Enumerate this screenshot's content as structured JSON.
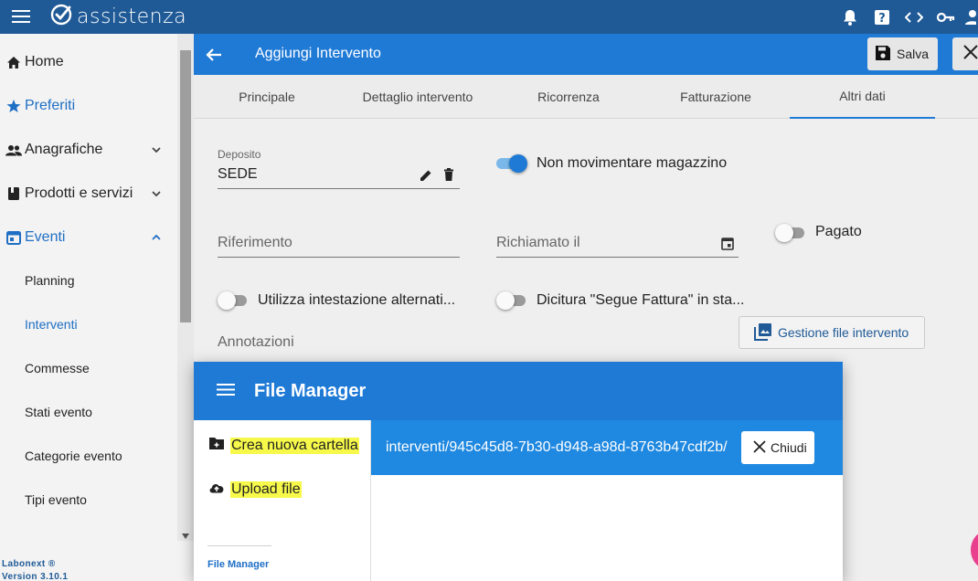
{
  "app": {
    "logo_text": "assistenza"
  },
  "sidebar": {
    "items": [
      {
        "label": "Home"
      },
      {
        "label": "Preferiti"
      },
      {
        "label": "Anagrafiche"
      },
      {
        "label": "Prodotti e servizi"
      },
      {
        "label": "Eventi"
      }
    ],
    "sub_items": [
      {
        "label": "Planning"
      },
      {
        "label": "Interventi"
      },
      {
        "label": "Commesse"
      },
      {
        "label": "Stati evento"
      },
      {
        "label": "Categorie evento"
      },
      {
        "label": "Tipi evento"
      }
    ],
    "footer_name": "Labonext ®",
    "footer_version": "Version 3.10.1"
  },
  "form_header": {
    "title": "Aggiungi Intervento",
    "save_label": "Salva"
  },
  "tabs": [
    {
      "label": "Principale"
    },
    {
      "label": "Dettaglio intervento"
    },
    {
      "label": "Ricorrenza"
    },
    {
      "label": "Fatturazione"
    },
    {
      "label": "Altri dati"
    }
  ],
  "form": {
    "deposito_label": "Deposito",
    "deposito_value": "SEDE",
    "non_movimentare_label": "Non movimentare magazzino",
    "riferimento_label": "Riferimento",
    "richiamato_label": "Richiamato il",
    "pagato_label": "Pagato",
    "intestazione_label": "Utilizza intestazione alternati...",
    "dicitura_label": "Dicitura \"Segue Fattura\" in sta...",
    "annotazioni_label": "Annotazioni",
    "gestione_button": "Gestione file intervento"
  },
  "file_manager": {
    "title": "File Manager",
    "new_folder": "Crea nuova cartella",
    "upload": "Upload file",
    "footer": "File Manager",
    "path": "interventi/945c45d8-7b30-d948-a98d-8763b47cdf2b/",
    "close_label": "Chiudi"
  },
  "colors": {
    "appbar": "#1f5a97",
    "primary": "#1f7ad6",
    "highlight": "#f7f94a"
  }
}
